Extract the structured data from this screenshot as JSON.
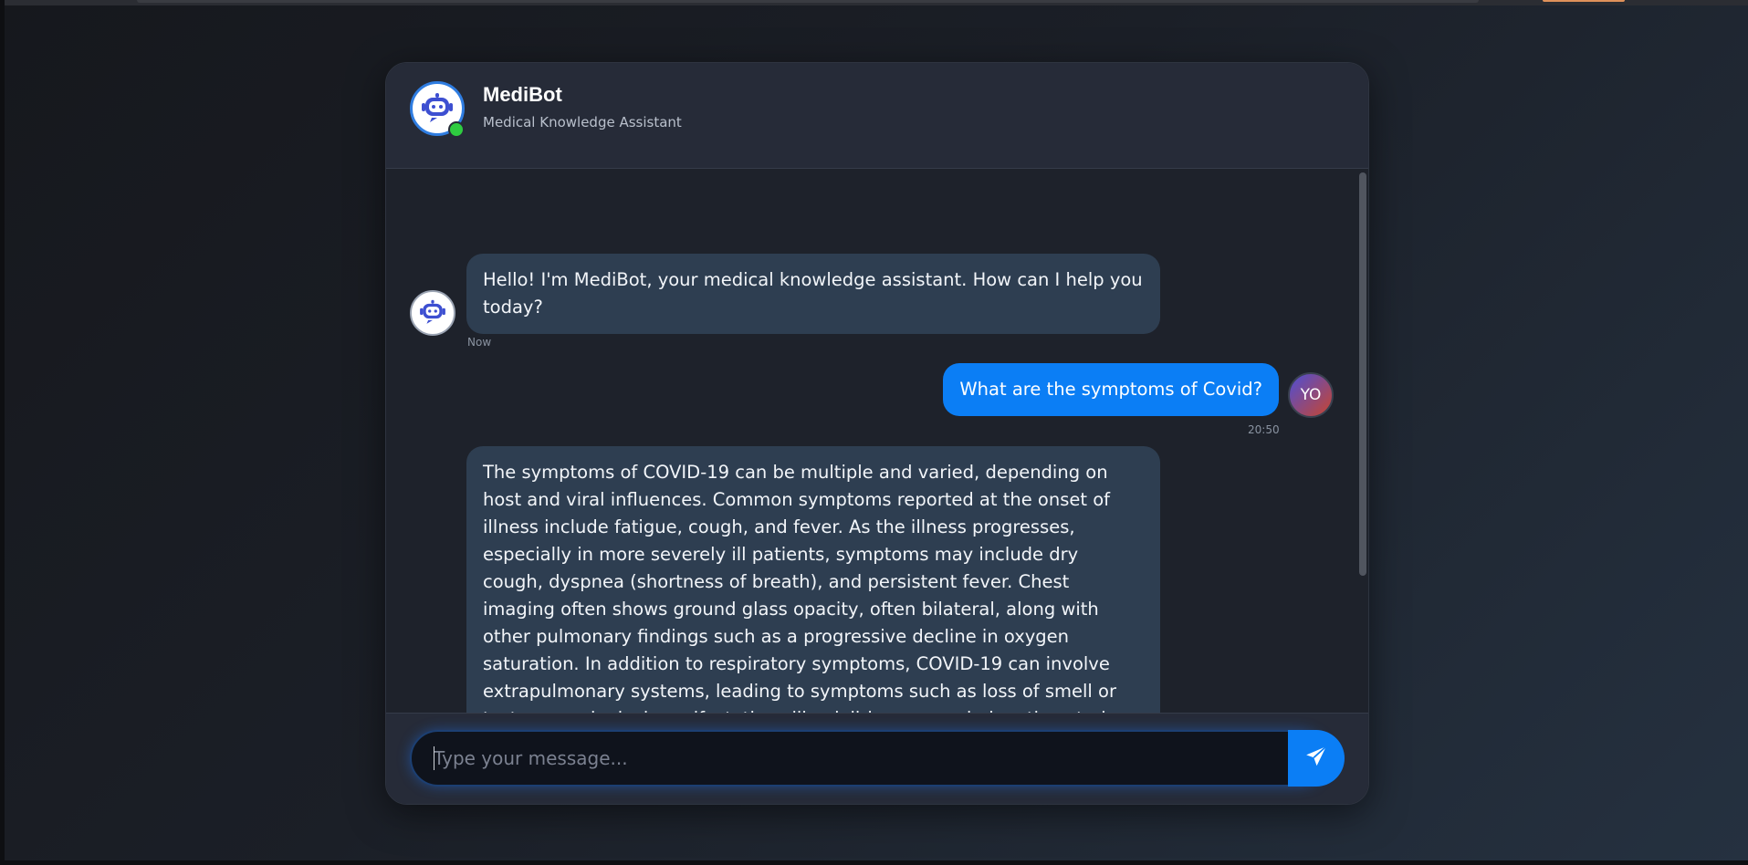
{
  "header": {
    "bot_name": "MediBot",
    "bot_subtitle": "Medical Knowledge Assistant",
    "status": "online"
  },
  "messages": [
    {
      "sender": "bot",
      "text": "Hello! I'm MediBot, your medical knowledge assistant. How can I help you today?",
      "time": "Now"
    },
    {
      "sender": "user",
      "avatar_initials": "YO",
      "text": "What are the symptoms of Covid?",
      "time": "20:50"
    },
    {
      "sender": "bot",
      "text": "The symptoms of COVID-19 can be multiple and varied, depending on host and viral influences. Common symptoms reported at the onset of illness include fatigue, cough, and fever. As the illness progresses, especially in more severely ill patients, symptoms may include dry cough, dyspnea (shortness of breath), and persistent fever. Chest imaging often shows ground glass opacity, often bilateral, along with other pulmonary findings such as a progressive decline in oxygen saturation. In addition to respiratory symptoms, COVID-19 can involve extrapulmonary systems, leading to symptoms such as loss of smell or taste, neurological manifestations like delirium, encephalopathy, stroke, meningoencephalitis, and mental health issues like anxiety and depression. Cardiovascular involvement is also documented. The"
    }
  ],
  "composer": {
    "placeholder": "Type your message...",
    "value": ""
  },
  "colors": {
    "accent": "#0b7ef5",
    "online": "#2ecc40",
    "bot_bubble": "#2e3e51",
    "card_bg": "#1e222b",
    "header_bg": "#262b38"
  },
  "icons": {
    "header_avatar": "robot-icon",
    "bot_avatar": "robot-icon",
    "send": "paper-plane-icon"
  }
}
